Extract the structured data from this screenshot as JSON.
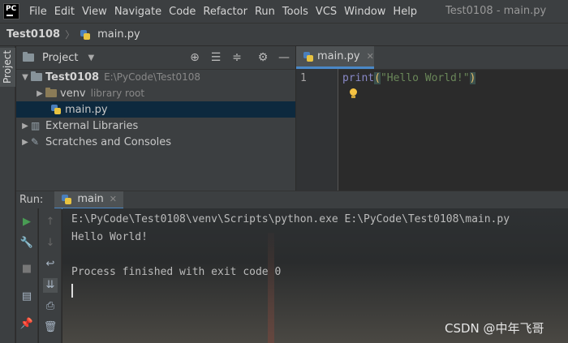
{
  "app": {
    "logo_text": "PC",
    "menu": [
      "File",
      "Edit",
      "View",
      "Navigate",
      "Code",
      "Refactor",
      "Run",
      "Tools",
      "VCS",
      "Window",
      "Help"
    ],
    "window_title": "Test0108 - main.py"
  },
  "breadcrumb": {
    "project": "Test0108",
    "file": "main.py"
  },
  "left_stripe": {
    "project_label": "Project"
  },
  "project_pane": {
    "title": "Project",
    "tree": [
      {
        "label": "Test0108",
        "hint": "E:\\PyCode\\Test0108"
      },
      {
        "label": "venv",
        "hint": "library root"
      },
      {
        "label": "main.py"
      },
      {
        "label": "External Libraries"
      },
      {
        "label": "Scratches and Consoles"
      }
    ]
  },
  "editor": {
    "tab": "main.py",
    "line_number": "1",
    "code": {
      "keyword": "print",
      "open": "(",
      "string": "\"Hello World!\"",
      "close": ")"
    }
  },
  "run_panel": {
    "label": "Run:",
    "tab": "main",
    "console_lines": [
      "E:\\PyCode\\Test0108\\venv\\Scripts\\python.exe E:\\PyCode\\Test0108\\main.py",
      "Hello World!",
      "",
      "Process finished with exit code 0"
    ]
  },
  "watermark": "CSDN @中年飞哥",
  "colors": {
    "accent": "#4a88c7",
    "selection": "#0d293e",
    "run_green": "#499c54"
  }
}
